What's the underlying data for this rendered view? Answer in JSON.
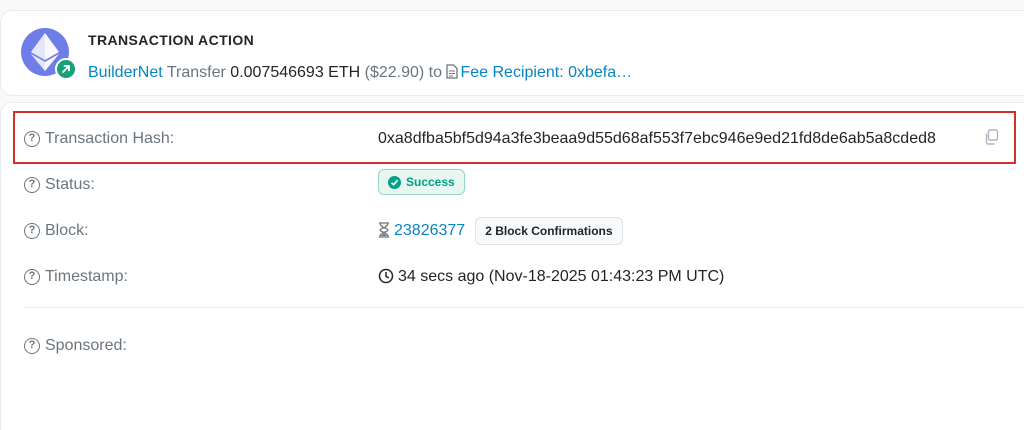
{
  "action": {
    "title": "TRANSACTION ACTION",
    "from": "BuilderNet",
    "verb": "Transfer",
    "amount": "0.007546693 ETH",
    "usd": "($22.90)",
    "to_word": "to",
    "recipient": "Fee Recipient: 0xbefa…",
    "icons": {
      "token": "eth-icon",
      "direction": "arrow-up-right-icon",
      "contract": "document-icon"
    },
    "colors": {
      "eth": "#6f7de8",
      "badge": "#1aa079",
      "link": "#0784c3"
    }
  },
  "details": {
    "hash": {
      "label": "Transaction Hash:",
      "value": "0xa8dfba5bf5d94a3fe3beaa9d55d68af553f7ebc946e9ed21fd8de6ab5a8cded8"
    },
    "status": {
      "label": "Status:",
      "value": "Success",
      "color": "#00a186"
    },
    "block": {
      "label": "Block:",
      "number": "23826377",
      "confirmations": "2 Block Confirmations"
    },
    "timestamp": {
      "label": "Timestamp:",
      "value": "34 secs ago (Nov-18-2025 01:43:23 PM UTC)"
    },
    "sponsored": {
      "label": "Sponsored:"
    }
  },
  "highlight_color": "#d32f2f"
}
